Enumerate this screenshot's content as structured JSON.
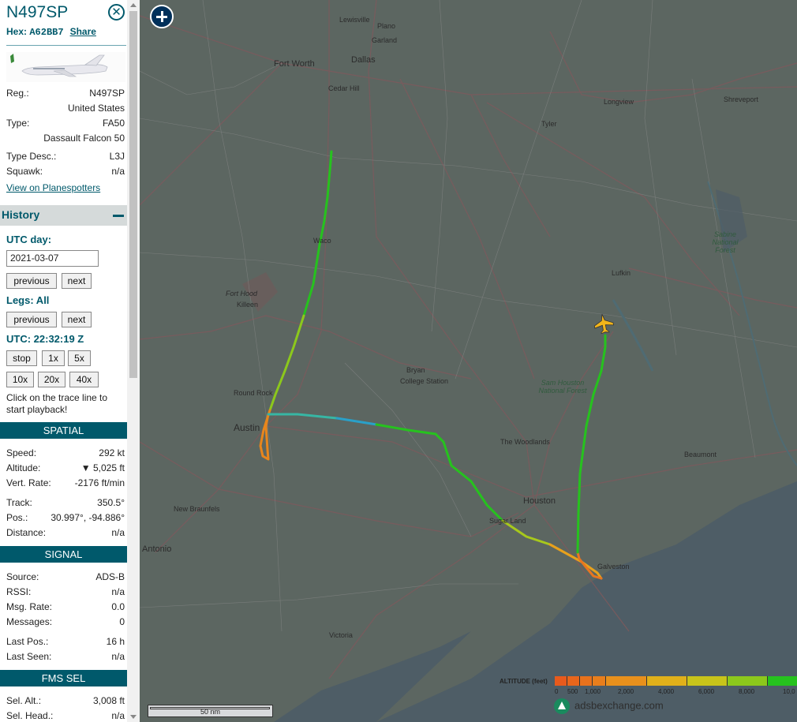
{
  "aircraft": {
    "callsign": "N497SP",
    "hex_label": "Hex:",
    "hex": "A62BB7",
    "share": "Share",
    "reg_label": "Reg.:",
    "reg": "N497SP",
    "country": "United States",
    "type_label": "Type:",
    "type": "FA50",
    "type_name": "Dassault Falcon 50",
    "type_desc_label": "Type Desc.:",
    "type_desc": "L3J",
    "squawk_label": "Squawk:",
    "squawk": "n/a",
    "planespotters": "View on Planespotters"
  },
  "history": {
    "header": "History",
    "utc_day_label": "UTC day:",
    "date": "2021-03-07",
    "previous": "previous",
    "next": "next",
    "legs_label": "Legs: All",
    "utc_label": "UTC: 22:32:19 Z",
    "speeds": [
      "stop",
      "1x",
      "5x",
      "10x",
      "20x",
      "40x"
    ],
    "hint": "Click on the trace line to start playback!"
  },
  "spatial": {
    "header": "SPATIAL",
    "speed_label": "Speed:",
    "speed": "292 kt",
    "alt_label": "Altitude:",
    "alt": "▼ 5,025 ft",
    "vrate_label": "Vert. Rate:",
    "vrate": "-2176 ft/min",
    "track_label": "Track:",
    "track": "350.5°",
    "pos_label": "Pos.:",
    "pos": "30.997°, -94.886°",
    "dist_label": "Distance:",
    "dist": "n/a"
  },
  "signal": {
    "header": "SIGNAL",
    "source_label": "Source:",
    "source": "ADS-B",
    "rssi_label": "RSSI:",
    "rssi": "n/a",
    "msgrate_label": "Msg. Rate:",
    "msgrate": "0.0",
    "messages_label": "Messages:",
    "messages": "0",
    "lastpos_label": "Last Pos.:",
    "lastpos": "16 h",
    "lastseen_label": "Last Seen:",
    "lastseen": "n/a"
  },
  "fms": {
    "header": "FMS SEL",
    "selalt_label": "Sel. Alt.:",
    "selalt": "3,008 ft",
    "selhead_label": "Sel. Head.:",
    "selhead": "n/a"
  },
  "map": {
    "cities": [
      "Lewisville",
      "Plano",
      "Garland",
      "Fort Worth",
      "Dallas",
      "Cedar Hill",
      "Longview",
      "Shreveport",
      "Tyler",
      "Waco",
      "Fort Hood",
      "Killeen",
      "Lufkin",
      "Bryan",
      "College Station",
      "Round Rock",
      "Austin",
      "The Woodlands",
      "Beaumont",
      "New Braunfels",
      "Houston",
      "Sugar Land",
      "Antonio",
      "Galveston",
      "Victoria"
    ],
    "parks": [
      "Sabine National Forest",
      "Sam Houston National Forest"
    ],
    "scale_label": "50 nm",
    "legend_title": "ALTITUDE (feet)",
    "legend_ticks": [
      "0",
      "500",
      "1,000",
      "2,000",
      "4,000",
      "6,000",
      "8,000",
      "10,0"
    ],
    "brand": "adsbexchange.com",
    "colors": {
      "orange": "#e8761c",
      "yellow": "#dcbb12",
      "green": "#26c21e",
      "cyan": "#2aa0c8",
      "teal": "#00596b"
    }
  }
}
